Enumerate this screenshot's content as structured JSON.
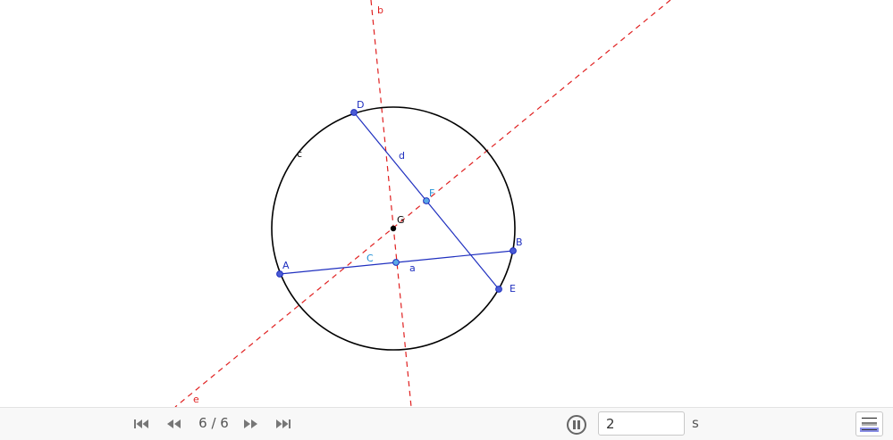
{
  "construction": {
    "points": {
      "A": {
        "label": "A",
        "color": "#1f2fbf"
      },
      "B": {
        "label": "B",
        "color": "#1f2fbf"
      },
      "C": {
        "label": "C",
        "color": "#1e8fd6"
      },
      "D": {
        "label": "D",
        "color": "#1f2fbf"
      },
      "E": {
        "label": "E",
        "color": "#1f2fbf"
      },
      "F": {
        "label": "F",
        "color": "#1e8fd6"
      },
      "G": {
        "label": "G",
        "color": "#000000"
      }
    },
    "circle": {
      "label": "c",
      "color": "#000000"
    },
    "segments": {
      "a": {
        "label": "a",
        "color": "#1f2fbf"
      },
      "d": {
        "label": "d",
        "color": "#1f2fbf"
      }
    },
    "bisectors": {
      "b": {
        "label": "b",
        "color": "#e02020"
      },
      "e": {
        "label": "e",
        "color": "#e02020"
      }
    }
  },
  "toolbar": {
    "step_counter": "6 / 6",
    "speed_value": "2",
    "speed_unit": "s",
    "algebra_icon": "algebra-view-icon",
    "nav_icons": [
      "first-step-icon",
      "previous-step-icon",
      "next-step-icon",
      "last-step-icon"
    ],
    "pause_icon": "pause-icon"
  }
}
